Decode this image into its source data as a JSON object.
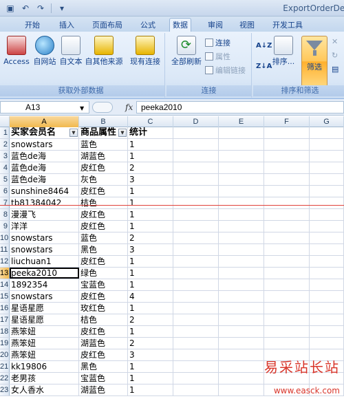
{
  "window": {
    "title": "ExportOrderDet"
  },
  "qat": {
    "save_icon": "save-icon",
    "undo_icon": "undo-icon",
    "redo_icon": "redo-icon"
  },
  "tabs": [
    {
      "label": "开始"
    },
    {
      "label": "插入"
    },
    {
      "label": "页面布局"
    },
    {
      "label": "公式"
    },
    {
      "label": "数据",
      "active": true
    },
    {
      "label": "审阅"
    },
    {
      "label": "视图"
    },
    {
      "label": "开发工具"
    }
  ],
  "ribbon": {
    "external": {
      "group_label": "获取外部数据",
      "access": "Access",
      "web": "自网站",
      "text": "自文本",
      "other": "自其他来源",
      "existing": "现有连接"
    },
    "connections": {
      "group_label": "连接",
      "refresh_all": "全部刷新",
      "connections": "连接",
      "properties": "属性",
      "edit_links": "编辑链接"
    },
    "sort_filter": {
      "group_label": "排序和筛选",
      "sort": "排序...",
      "filter": "筛选",
      "sort_az": "A↓Z",
      "sort_za": "Z↓A"
    }
  },
  "formula_bar": {
    "name_box": "A13",
    "fx": "fx",
    "value": "peeka2010"
  },
  "columns": [
    "A",
    "B",
    "C",
    "D",
    "E",
    "F",
    "G"
  ],
  "rows": [
    {
      "num": "1",
      "a": "买家会员名",
      "b": "商品属性",
      "c": "统计",
      "header": true
    },
    {
      "num": "2",
      "a": "snowstars",
      "b": "蓝色",
      "c": "1"
    },
    {
      "num": "3",
      "a": "蓝色de海",
      "b": "湖蓝色",
      "c": "1"
    },
    {
      "num": "4",
      "a": "蓝色de海",
      "b": "皮红色",
      "c": "2"
    },
    {
      "num": "5",
      "a": "蓝色de海",
      "b": "灰色",
      "c": "3"
    },
    {
      "num": "6",
      "a": "sunshine8464",
      "b": "皮红色",
      "c": "1"
    },
    {
      "num": "7",
      "a": "tb81384042",
      "b": "桔色",
      "c": "1"
    },
    {
      "num": "8",
      "a": "漫漫飞",
      "b": "皮红色",
      "c": "1"
    },
    {
      "num": "9",
      "a": "洋洋",
      "b": "皮红色",
      "c": "1"
    },
    {
      "num": "10",
      "a": "snowstars",
      "b": "蓝色",
      "c": "2"
    },
    {
      "num": "11",
      "a": "snowstars",
      "b": "黑色",
      "c": "3"
    },
    {
      "num": "12",
      "a": "liuchuan1",
      "b": "皮红色",
      "c": "1"
    },
    {
      "num": "13",
      "a": "peeka2010",
      "b": "绿色",
      "c": "1",
      "active": true
    },
    {
      "num": "14",
      "a": "1892354",
      "b": "宝蓝色",
      "c": "1"
    },
    {
      "num": "15",
      "a": "snowstars",
      "b": "皮红色",
      "c": "4"
    },
    {
      "num": "16",
      "a": "星语星愿",
      "b": "玫红色",
      "c": "1"
    },
    {
      "num": "17",
      "a": "星语星愿",
      "b": "桔色",
      "c": "2"
    },
    {
      "num": "18",
      "a": "燕笨妞",
      "b": "皮红色",
      "c": "1"
    },
    {
      "num": "19",
      "a": "燕笨妞",
      "b": "湖蓝色",
      "c": "2"
    },
    {
      "num": "20",
      "a": "燕笨妞",
      "b": "皮红色",
      "c": "3"
    },
    {
      "num": "21",
      "a": "kk19806",
      "b": "黑色",
      "c": "1"
    },
    {
      "num": "22",
      "a": "老男孩",
      "b": "宝蓝色",
      "c": "1"
    },
    {
      "num": "23",
      "a": "女人香水",
      "b": "湖蓝色",
      "c": "1"
    }
  ],
  "watermark": {
    "title": "易采站长站",
    "url": "www.easck.com"
  },
  "colors": {
    "accent": "#ffc75a",
    "red_line": "#e0403a",
    "watermark": "#d8352a"
  }
}
